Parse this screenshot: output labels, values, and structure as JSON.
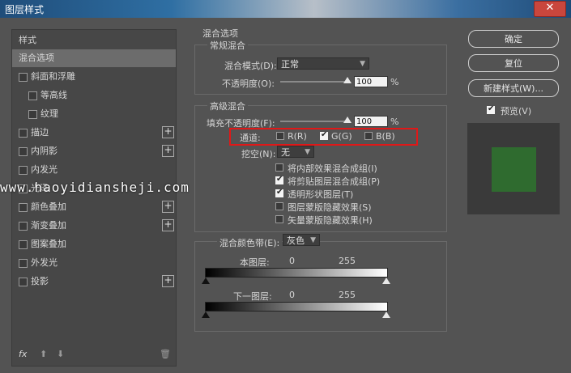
{
  "window": {
    "title": "图层样式",
    "close": "✕"
  },
  "left": {
    "head": "样式",
    "items": [
      {
        "label": "混合选项",
        "kind": "selected"
      },
      {
        "label": "斜面和浮雕",
        "kind": "cb"
      },
      {
        "label": "等高线",
        "kind": "sub"
      },
      {
        "label": "纹理",
        "kind": "sub"
      },
      {
        "label": "描边",
        "kind": "cb",
        "plus": true
      },
      {
        "label": "内阴影",
        "kind": "cb",
        "plus": true
      },
      {
        "label": "内发光",
        "kind": "cb"
      },
      {
        "label": "光泽",
        "kind": "cb"
      },
      {
        "label": "颜色叠加",
        "kind": "cb",
        "plus": true
      },
      {
        "label": "渐变叠加",
        "kind": "cb",
        "plus": true
      },
      {
        "label": "图案叠加",
        "kind": "cb"
      },
      {
        "label": "外发光",
        "kind": "cb"
      },
      {
        "label": "投影",
        "kind": "cb",
        "plus": true
      }
    ],
    "bottom": {
      "fx": "fx",
      "up": "⬆",
      "down": "⬇",
      "trash": "🗑"
    }
  },
  "blend": {
    "section_title": "混合选项",
    "general": {
      "title": "常规混合",
      "mode_label": "混合模式(D):",
      "mode_value": "正常",
      "opacity_label": "不透明度(O):",
      "opacity_value": "100",
      "unit": "%"
    },
    "advanced": {
      "title": "高级混合",
      "fill_label": "填充不透明度(F):",
      "fill_value": "100",
      "unit": "%",
      "channels_label": "通道:",
      "r_label": "R(R)",
      "g_label": "G(G)",
      "b_label": "B(B)",
      "knockout_label": "挖空(N):",
      "knockout_value": "无",
      "options": [
        {
          "label": "将内部效果混合成组(I)",
          "checked": false
        },
        {
          "label": "将剪贴图层混合成组(P)",
          "checked": true
        },
        {
          "label": "透明形状图层(T)",
          "checked": true
        },
        {
          "label": "图层蒙版隐藏效果(S)",
          "checked": false
        },
        {
          "label": "矢量蒙版隐藏效果(H)",
          "checked": false
        }
      ]
    },
    "band": {
      "label": "混合颜色带(E):",
      "value": "灰色",
      "this_layer": "本图层:",
      "underlying": "下一图层:",
      "min": "0",
      "max": "255"
    }
  },
  "right": {
    "ok": "确定",
    "reset": "复位",
    "new_style": "新建样式(W)...",
    "preview_label": "预览(V)"
  },
  "watermark": "www.haoyidiansheji.com",
  "colors": {
    "preview_swatch": "#2f6b2f",
    "highlight": "#e01818"
  }
}
